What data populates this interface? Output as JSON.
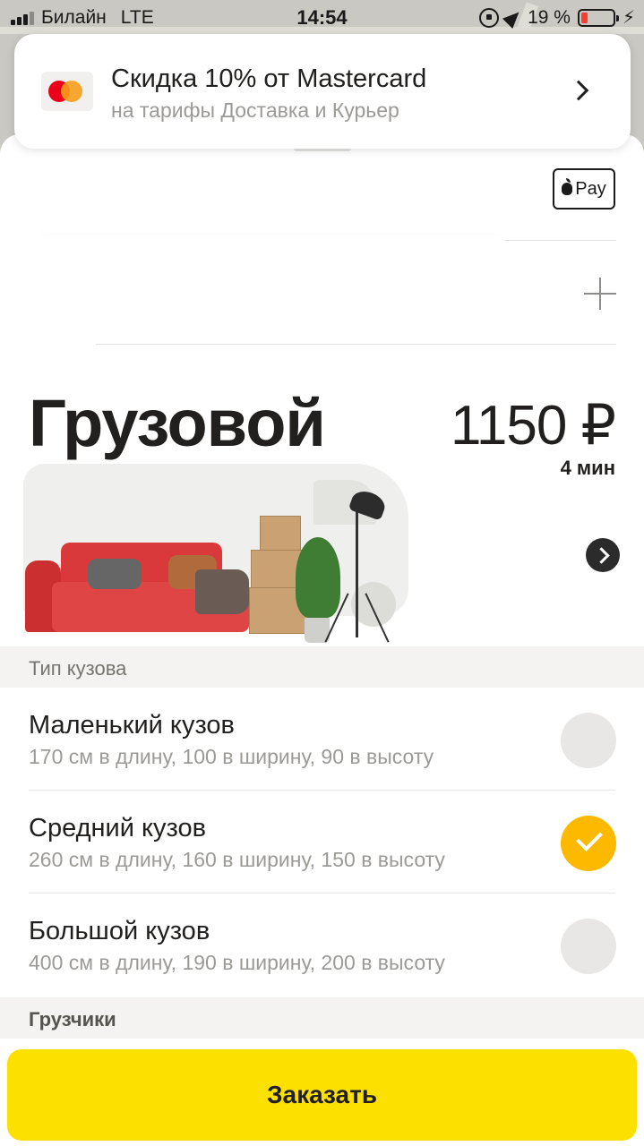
{
  "status_bar": {
    "carrier": "Билайн",
    "network": "LTE",
    "time": "14:54",
    "battery": "19 %",
    "battery_color": "#ff3b30"
  },
  "promo": {
    "title": "Скидка 10% от Mastercard",
    "subtitle": "на тарифы Доставка и Курьер",
    "icon": "mastercard-logo"
  },
  "payment": {
    "label": "Pay",
    "icon": "apple-pay-icon"
  },
  "tariff": {
    "name": "Грузовой",
    "price": "1150 ₽",
    "eta": "4 мин"
  },
  "body_type": {
    "header": "Тип кузова",
    "options": [
      {
        "title": "Маленький кузов",
        "desc": "170 см в длину, 100 в ширину, 90 в высоту",
        "selected": false
      },
      {
        "title": "Средний кузов",
        "desc": "260 см в длину, 160 в ширину, 150 в высоту",
        "selected": true
      },
      {
        "title": "Большой кузов",
        "desc": "400 см в длину, 190 в ширину, 200 в высоту",
        "selected": false
      }
    ]
  },
  "loaders": {
    "header": "Грузчики"
  },
  "order_button": {
    "label": "Заказать",
    "color": "#fce000"
  },
  "colors": {
    "accent_check": "#fcb900"
  }
}
